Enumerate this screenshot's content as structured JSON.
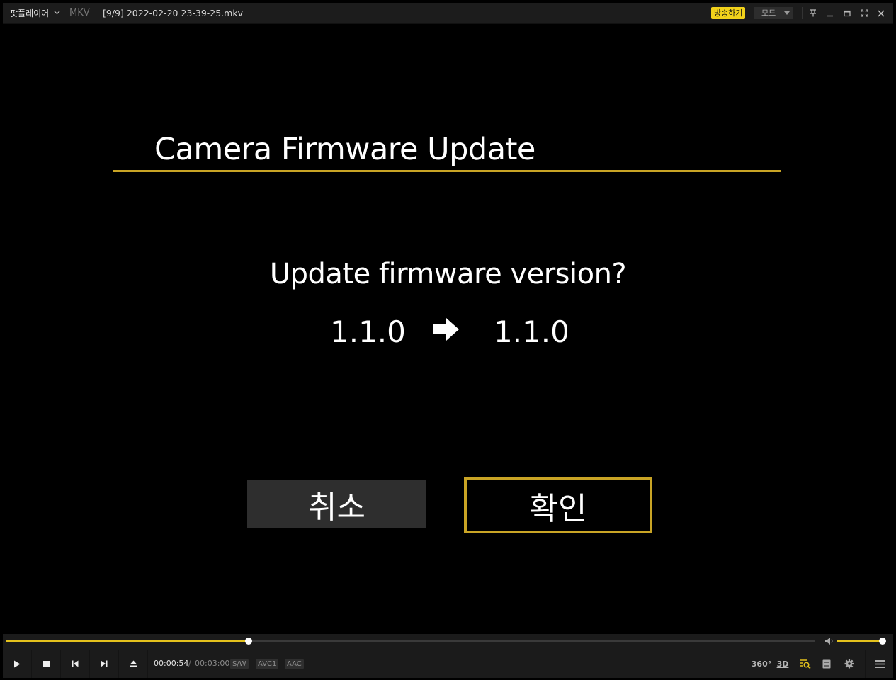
{
  "titlebar": {
    "app_menu": "팟플레이어",
    "format": "MKV",
    "filename": "[9/9]  2022-02-20  23-39-25.mkv",
    "broadcast_label": "방송하기",
    "mode_label": "모드"
  },
  "video": {
    "title": "Camera Firmware Update",
    "question": "Update firmware version?",
    "version_current": "1.1.0",
    "version_new": "1.1.0",
    "cancel_label": "취소",
    "ok_label": "확인"
  },
  "controls": {
    "time_current": "00:00:54",
    "time_separator": "/",
    "time_total": "00:03:00",
    "tags": [
      "S/W",
      "AVC1",
      "AAC"
    ],
    "seek_fraction": 0.3,
    "volume_fraction": 1.0,
    "icon_360": "360°",
    "icon_3d": "3D"
  },
  "colors": {
    "accent": "#e4c21d",
    "highlight_border": "#c9a425",
    "broadcast_bg": "#f2d21b"
  }
}
